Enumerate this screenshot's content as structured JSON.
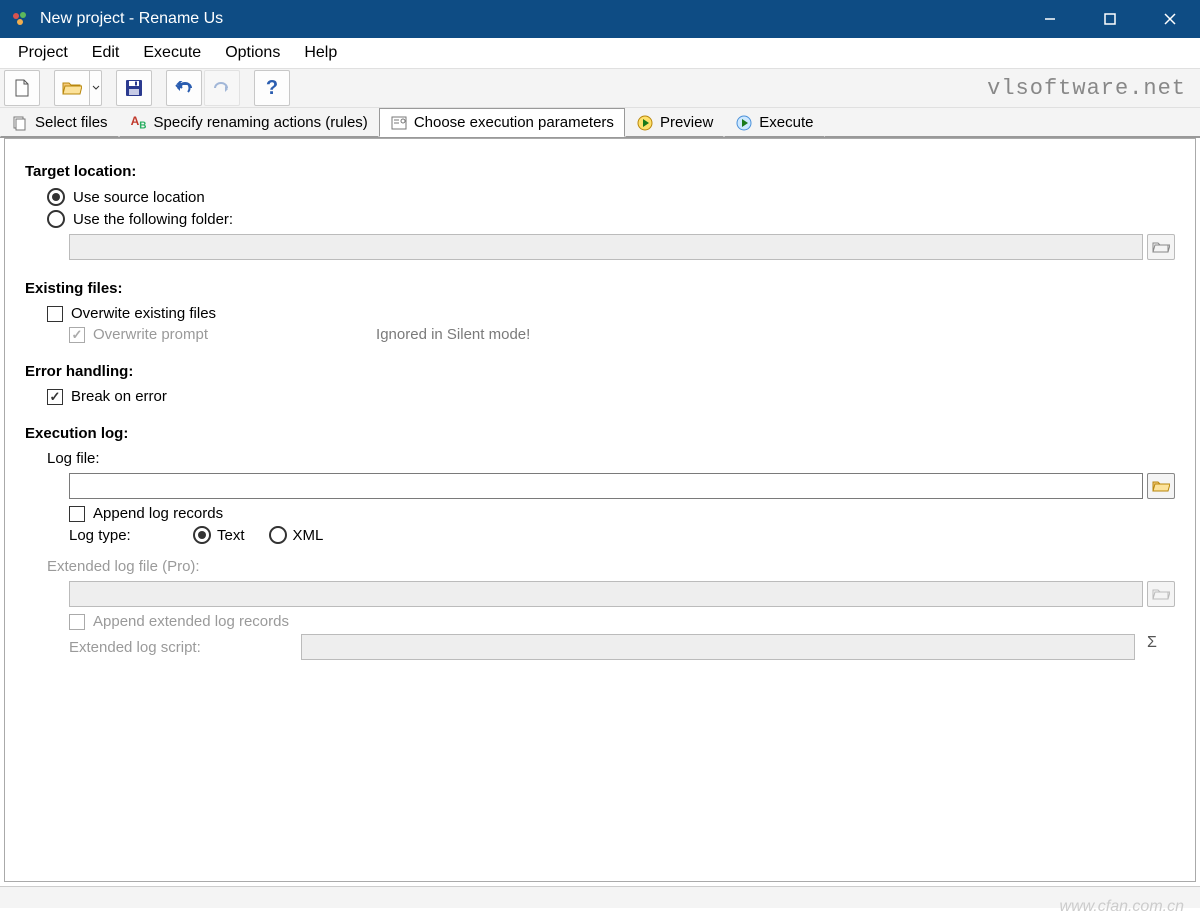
{
  "window": {
    "title": "New project - Rename Us"
  },
  "menu": {
    "items": [
      "Project",
      "Edit",
      "Execute",
      "Options",
      "Help"
    ]
  },
  "toolbar": {
    "brand": "vlsoftware.net"
  },
  "tabs": {
    "items": [
      {
        "label": "Select files",
        "icon": "files-icon"
      },
      {
        "label": "Specify renaming actions (rules)",
        "icon": "rules-icon"
      },
      {
        "label": "Choose execution parameters",
        "icon": "params-icon"
      },
      {
        "label": "Preview",
        "icon": "play-icon"
      },
      {
        "label": "Execute",
        "icon": "play-icon"
      }
    ],
    "activeIndex": 2
  },
  "form": {
    "targetLocation": {
      "title": "Target location:",
      "useSourceLabel": "Use source location",
      "useFolderLabel": "Use the following folder:",
      "selected": "source",
      "folderPath": ""
    },
    "existingFiles": {
      "title": "Existing files:",
      "overwriteLabel": "Overwite existing files",
      "overwriteChecked": false,
      "promptLabel": "Overwrite prompt",
      "promptChecked": true,
      "hint": "Ignored in Silent mode!"
    },
    "errorHandling": {
      "title": "Error handling:",
      "breakLabel": "Break on error",
      "breakChecked": true
    },
    "executionLog": {
      "title": "Execution log:",
      "logFileLabel": "Log file:",
      "logFilePath": "",
      "appendLabel": "Append log records",
      "appendChecked": false,
      "logTypeLabel": "Log type:",
      "textLabel": "Text",
      "xmlLabel": "XML",
      "logTypeSelected": "text",
      "extLogFileLabel": "Extended log file (Pro):",
      "extLogFilePath": "",
      "extAppendLabel": "Append extended log records",
      "extScriptLabel": "Extended log script:",
      "extScriptValue": ""
    }
  },
  "watermark": "www.cfan.com.cn"
}
